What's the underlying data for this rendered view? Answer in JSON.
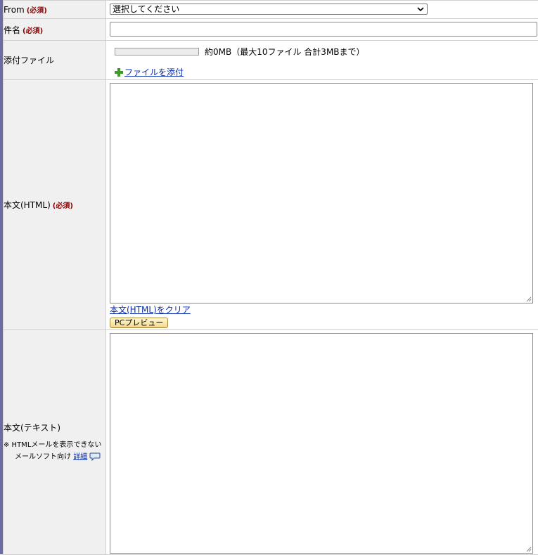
{
  "from": {
    "label": "From",
    "required": "(必須)",
    "selected": "選択してください"
  },
  "subject": {
    "label": "件名",
    "required": "(必須)",
    "value": ""
  },
  "attachment": {
    "label": "添付ファイル",
    "usage_fraction": 0,
    "size_text": "約0MB（最大10ファイル 合計3MBまで）",
    "add_link": "ファイルを添付"
  },
  "body_html": {
    "label": "本文(HTML)",
    "required": "(必須)",
    "value": "",
    "clear_link": "本文(HTML)をクリア",
    "preview_button": "PCプレビュー"
  },
  "body_text": {
    "label": "本文(テキスト)",
    "note_line1": "※ HTMLメールを表示できない",
    "note_line2": "メールソフト向け",
    "detail_link": "詳細",
    "value": ""
  }
}
